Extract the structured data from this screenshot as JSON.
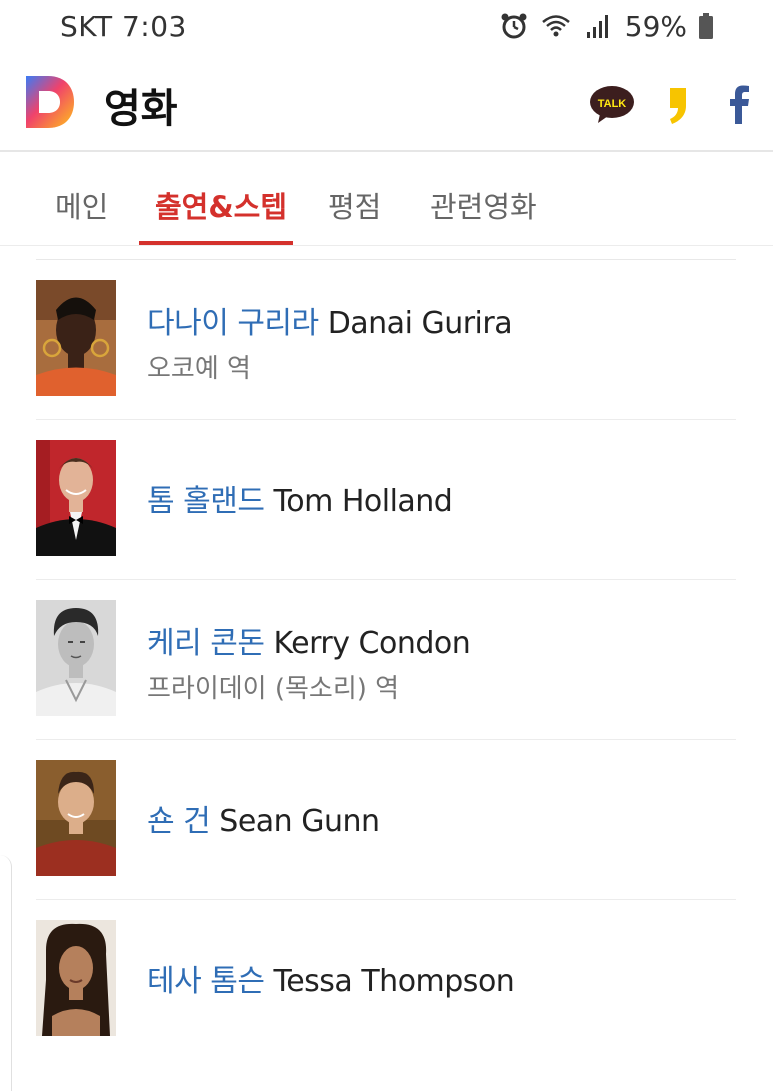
{
  "status_bar": {
    "carrier_time": "SKT 7:03",
    "battery": "59%",
    "icons": [
      "alarm-icon",
      "wifi-icon",
      "signal-icon",
      "battery-icon"
    ]
  },
  "header": {
    "logo": "D",
    "title": "영화",
    "share": {
      "talk_label": "TALK",
      "icons": [
        "kakaotalk-icon",
        "kakaostory-icon",
        "facebook-icon"
      ],
      "colors": {
        "talk": "#3c1e1e",
        "story": "#f7c400",
        "facebook": "#3b5998"
      }
    }
  },
  "tabs": [
    {
      "label": "메인",
      "active": false
    },
    {
      "label": "출연&스텝",
      "active": true
    },
    {
      "label": "평점",
      "active": false
    },
    {
      "label": "관련영화",
      "active": false
    }
  ],
  "accent_color": "#d4312c",
  "link_color": "#2f6db5",
  "cast": [
    {
      "name_ko": "다나이 구리라",
      "name_en": "Danai Gurira",
      "role": "오코예 역"
    },
    {
      "name_ko": "톰 홀랜드",
      "name_en": "Tom Holland",
      "role": ""
    },
    {
      "name_ko": "케리 콘돈",
      "name_en": "Kerry Condon",
      "role": "프라이데이 (목소리) 역"
    },
    {
      "name_ko": "숀 건",
      "name_en": "Sean Gunn",
      "role": ""
    },
    {
      "name_ko": "테사 톰슨",
      "name_en": "Tessa Thompson",
      "role": ""
    }
  ]
}
